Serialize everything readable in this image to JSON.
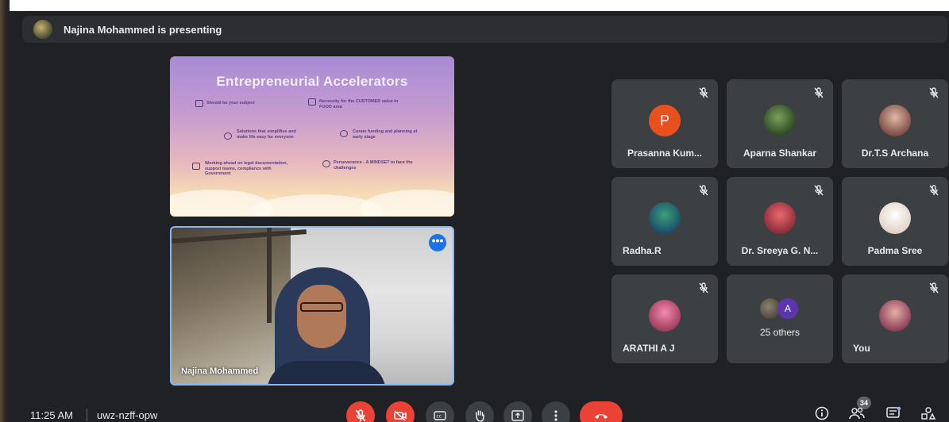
{
  "banner": {
    "text": "Najina Mohammed is presenting"
  },
  "slide": {
    "title": "Entrepreneurial Accelerators",
    "bullets": [
      "Should be your subject",
      "Necessity for the CUSTOMER value in FOOD area",
      "Solutions that simplifies and make life easy for everyone",
      "Curate funding and planning at early stage",
      "Working ahead on legal documentation, support teams, compliance with Government",
      "Perseverance - A MINDSET to face the challenges"
    ]
  },
  "speaker": {
    "name": "Najina Mohammed",
    "more_label": "•••"
  },
  "participants": [
    {
      "name": "Prasanna Kum...",
      "initial": "P",
      "color": "#e8501e",
      "mic": "muted"
    },
    {
      "name": "Aparna Shankar",
      "initial": "",
      "color": "#3a6b3a",
      "mic": "muted"
    },
    {
      "name": "Dr.T.S Archana",
      "initial": "",
      "color": "#d6a8a0",
      "mic": "muted"
    },
    {
      "name": "Radha.R",
      "initial": "",
      "color": "#2e7d5a",
      "mic": "muted"
    },
    {
      "name": "Dr. Sreeya G. N...",
      "initial": "",
      "color": "#c0485a",
      "mic": "muted"
    },
    {
      "name": "Padma Sree",
      "initial": "",
      "color": "#f0e4dc",
      "mic": "muted"
    },
    {
      "name": "ARATHI A J",
      "initial": "",
      "color": "#d95a8a",
      "mic": "muted"
    },
    {
      "name": "25 others",
      "initial": "A",
      "color": "#5e35b1",
      "mic": ""
    },
    {
      "name": "You",
      "initial": "",
      "color": "#c89080",
      "mic": "muted"
    }
  ],
  "bottom": {
    "time": "11:25 AM",
    "meeting_code": "uwz-nzff-opw",
    "participant_count": "34"
  },
  "icons": {
    "mic_off": "mic-off-icon",
    "cam_off": "camera-off-icon",
    "captions": "captions-icon",
    "hand": "raise-hand-icon",
    "present": "present-icon",
    "more": "more-vert-icon",
    "hangup": "hangup-icon",
    "info": "info-icon",
    "people": "people-icon",
    "chat": "chat-icon",
    "activities": "activities-icon"
  }
}
